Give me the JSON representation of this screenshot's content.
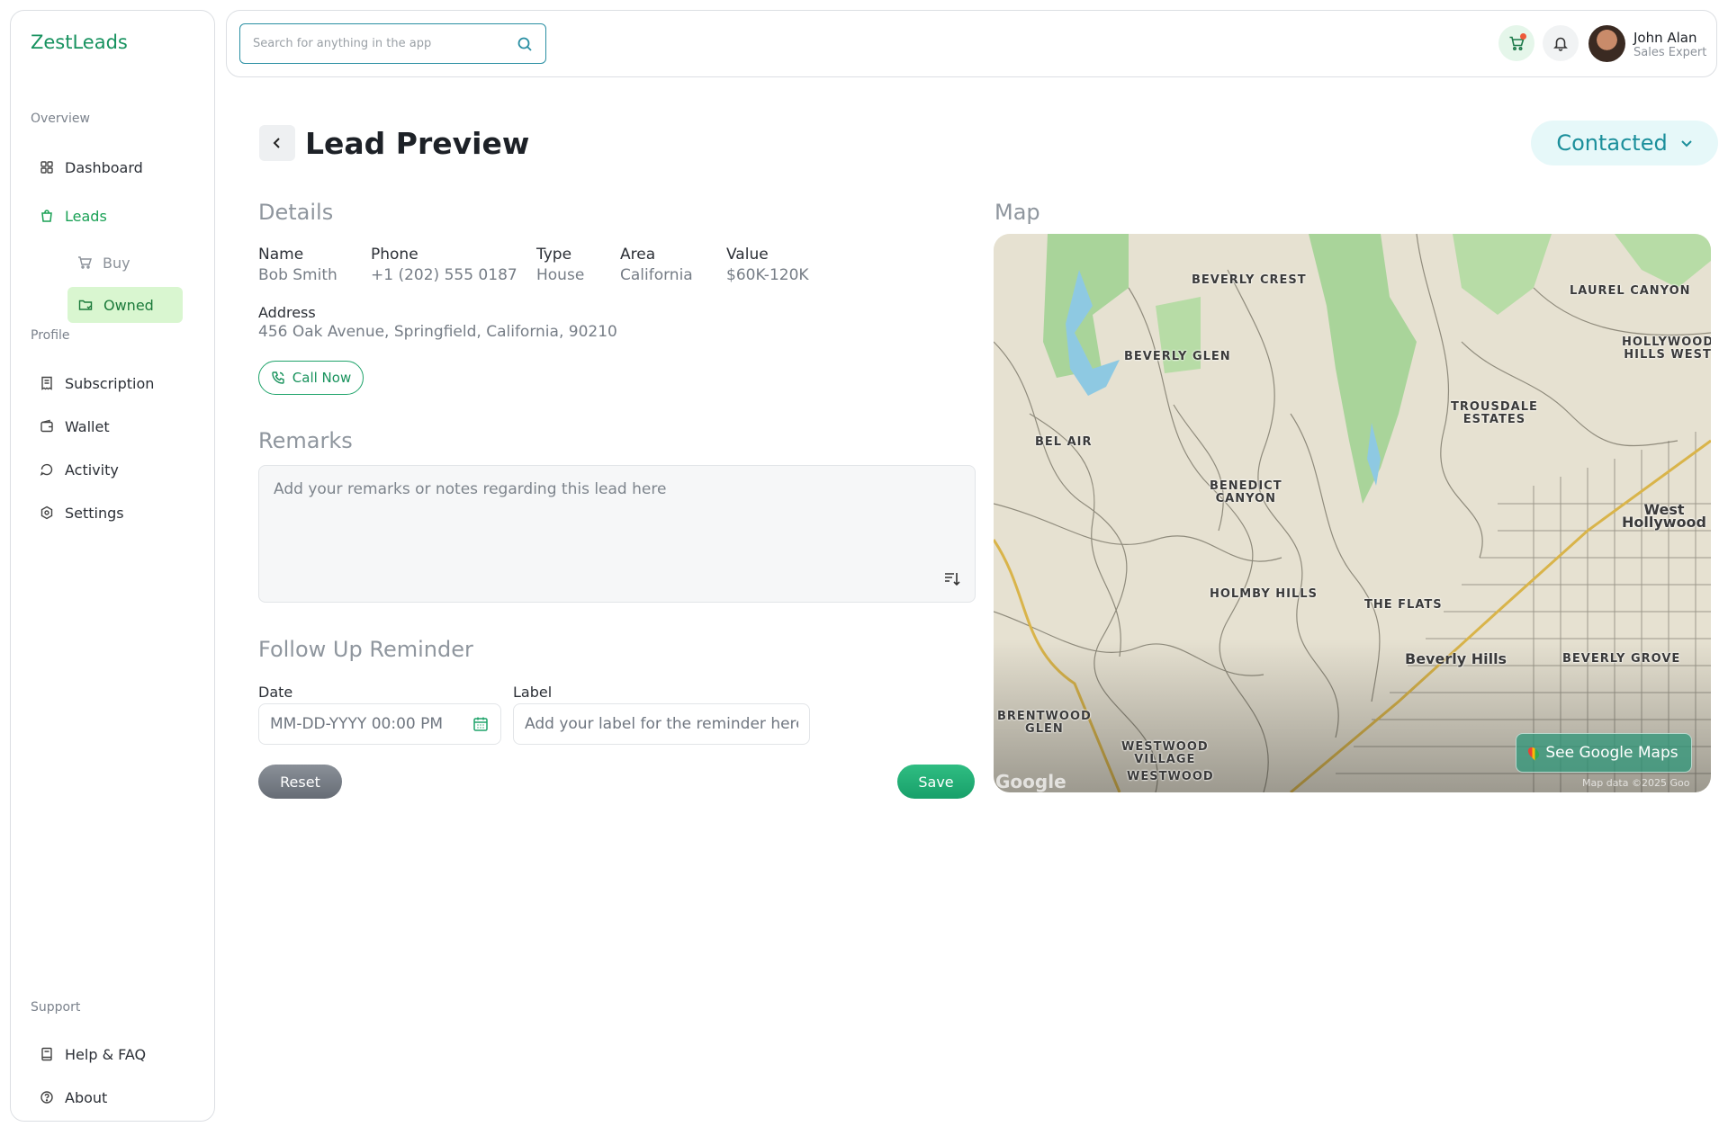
{
  "app": {
    "brand": "ZestLeads"
  },
  "sidebar": {
    "overview_label": "Overview",
    "profile_label": "Profile",
    "support_label": "Support",
    "items": {
      "dashboard": "Dashboard",
      "leads": "Leads",
      "buy": "Buy",
      "owned": "Owned",
      "subscription": "Subscription",
      "wallet": "Wallet",
      "activity": "Activity",
      "settings": "Settings",
      "help": "Help & FAQ",
      "about": "About"
    }
  },
  "topbar": {
    "search_placeholder": "Search for anything in the app",
    "user_name": "John Alan",
    "user_role": "Sales Expert"
  },
  "header": {
    "title": "Lead Preview",
    "status": "Contacted"
  },
  "details": {
    "heading": "Details",
    "name_label": "Name",
    "name": "Bob Smith",
    "phone_label": "Phone",
    "phone": "+1 (202) 555 0187",
    "type_label": "Type",
    "type": "House",
    "area_label": "Area",
    "area": "California",
    "value_label": "Value",
    "value": "$60K-120K",
    "address_label": "Address",
    "address": "456 Oak Avenue, Springfield, California, 90210",
    "call_button": "Call Now"
  },
  "remarks": {
    "heading": "Remarks",
    "placeholder": "Add your remarks or notes regarding this lead here"
  },
  "reminder": {
    "heading": "Follow Up Reminder",
    "date_label": "Date",
    "date_placeholder": "MM-DD-YYYY 00:00 PM",
    "label_label": "Label",
    "label_placeholder": "Add your label for the reminder here",
    "reset_button": "Reset",
    "save_button": "Save"
  },
  "map": {
    "heading": "Map",
    "places": {
      "beverly_crest": "BEVERLY CREST",
      "laurel_canyon": "LAUREL CANYON",
      "hollywood_hills_west_1": "HOLLYWOOD",
      "hollywood_hills_west_2": "HILLS WEST",
      "beverly_glen": "BEVERLY GLEN",
      "trousdale_1": "TROUSDALE",
      "trousdale_2": "ESTATES",
      "bel_air": "BEL AIR",
      "benedict_1": "BENEDICT",
      "benedict_2": "CANYON",
      "west_hollywood_1": "West",
      "west_hollywood_2": "Hollywood",
      "holmby_hills": "HOLMBY HILLS",
      "the_flats": "THE FLATS",
      "beverly_hills": "Beverly Hills",
      "beverly_grove": "BEVERLY GROVE",
      "brentwood_glen_1": "BRENTWOOD",
      "brentwood_glen_2": "GLEN",
      "westwood_village_1": "WESTWOOD",
      "westwood_village_2": "VILLAGE",
      "westwood": "WESTWOOD"
    },
    "google_logo": "Google",
    "attribution": "Map data ©2025 Goo",
    "see_button": "See Google Maps"
  }
}
